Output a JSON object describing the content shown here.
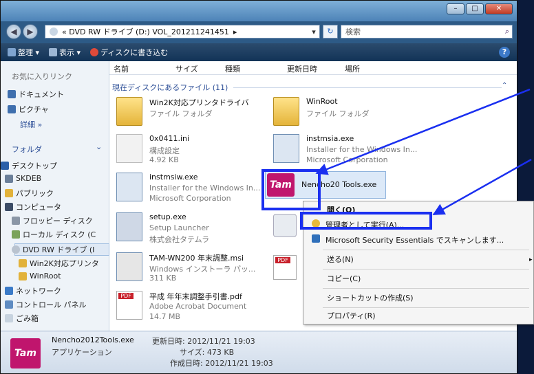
{
  "window": {
    "controls": [
      "–",
      "□",
      "✕"
    ]
  },
  "address": {
    "back": "◀",
    "forward": "▶",
    "path": "« DVD RW ドライブ (D:) VOL_201211241451",
    "sep": "▸",
    "dropdown": "▾",
    "refresh": "↻",
    "search_placeholder": "検索",
    "search_icon": "search-icon"
  },
  "toolbar": {
    "organize": "整理 ▾",
    "views": "表示 ▾",
    "burn": "ディスクに書き込む",
    "help": "?"
  },
  "sidebar": {
    "favorites_header": "お気に入りリンク",
    "favorites": [
      "ドキュメント",
      "ピクチャ",
      "詳細 »"
    ],
    "folders_header": "フォルダ",
    "folders_chevron": "⌄",
    "tree": [
      "デスクトップ",
      "SKDEB",
      "パブリック",
      "コンピュータ",
      "フロッピー ディスク",
      "ローカル ディスク (C",
      "DVD RW ドライブ (I",
      "Win2K対応プリンタ",
      "WinRoot",
      "ネットワーク",
      "コントロール パネル",
      "ごみ箱"
    ]
  },
  "columns": [
    "名前",
    "サイズ",
    "種類",
    "更新日時",
    "場所"
  ],
  "group_title": "現在ディスクにあるファイル (11)",
  "group_chevron": "⌃",
  "files": [
    {
      "name": "Win2K対応プリンタドライバ",
      "l2": "ファイル フォルダ",
      "l3": ""
    },
    {
      "name": "WinRoot",
      "l2": "ファイル フォルダ",
      "l3": ""
    },
    {
      "name": "0x0411.ini",
      "l2": "構成設定",
      "l3": "4.92 KB"
    },
    {
      "name": "instmsia.exe",
      "l2": "Installer for the Windows In...",
      "l3": "Microsoft Corporation"
    },
    {
      "name": "instmsiw.exe",
      "l2": "Installer for the Windows In...",
      "l3": "Microsoft Corporation"
    },
    {
      "name": "Nencho20 Tools.exe",
      "l2": "",
      "l3": ""
    },
    {
      "name": "setup.exe",
      "l2": "Setup Launcher",
      "l3": "株式会社タテムラ"
    },
    {
      "name": "TAM-WN200 年末調整.msi",
      "l2": "Windows インストーラ パッ...",
      "l3": "311 KB"
    },
    {
      "name": "平成 年年末調整手引書.pdf",
      "l2": "Adobe Acrobat Document",
      "l3": "14.7 MB"
    }
  ],
  "tam_logo_text": "Tam",
  "pdf_label": "PDF",
  "context_menu": {
    "open": "開く(O)",
    "run_as_admin": "管理者として実行(A)...",
    "mse_scan": "Microsoft Security Essentials でスキャンします...",
    "send_to": "送る(N)",
    "send_to_arrow": "▸",
    "copy": "コピー(C)",
    "create_shortcut": "ショートカットの作成(S)",
    "properties": "プロパティ(R)"
  },
  "details": {
    "name": "Nencho2012Tools.exe",
    "modified": "更新日時: 2012/11/21 19:03",
    "type": "アプリケーション",
    "size": "サイズ: 473 KB",
    "created": "作成日時: 2012/11/21 19:03"
  },
  "colors": {
    "highlight": "#1a2ff0",
    "tam_brand": "#c0156d",
    "toolbar": "#123357"
  }
}
